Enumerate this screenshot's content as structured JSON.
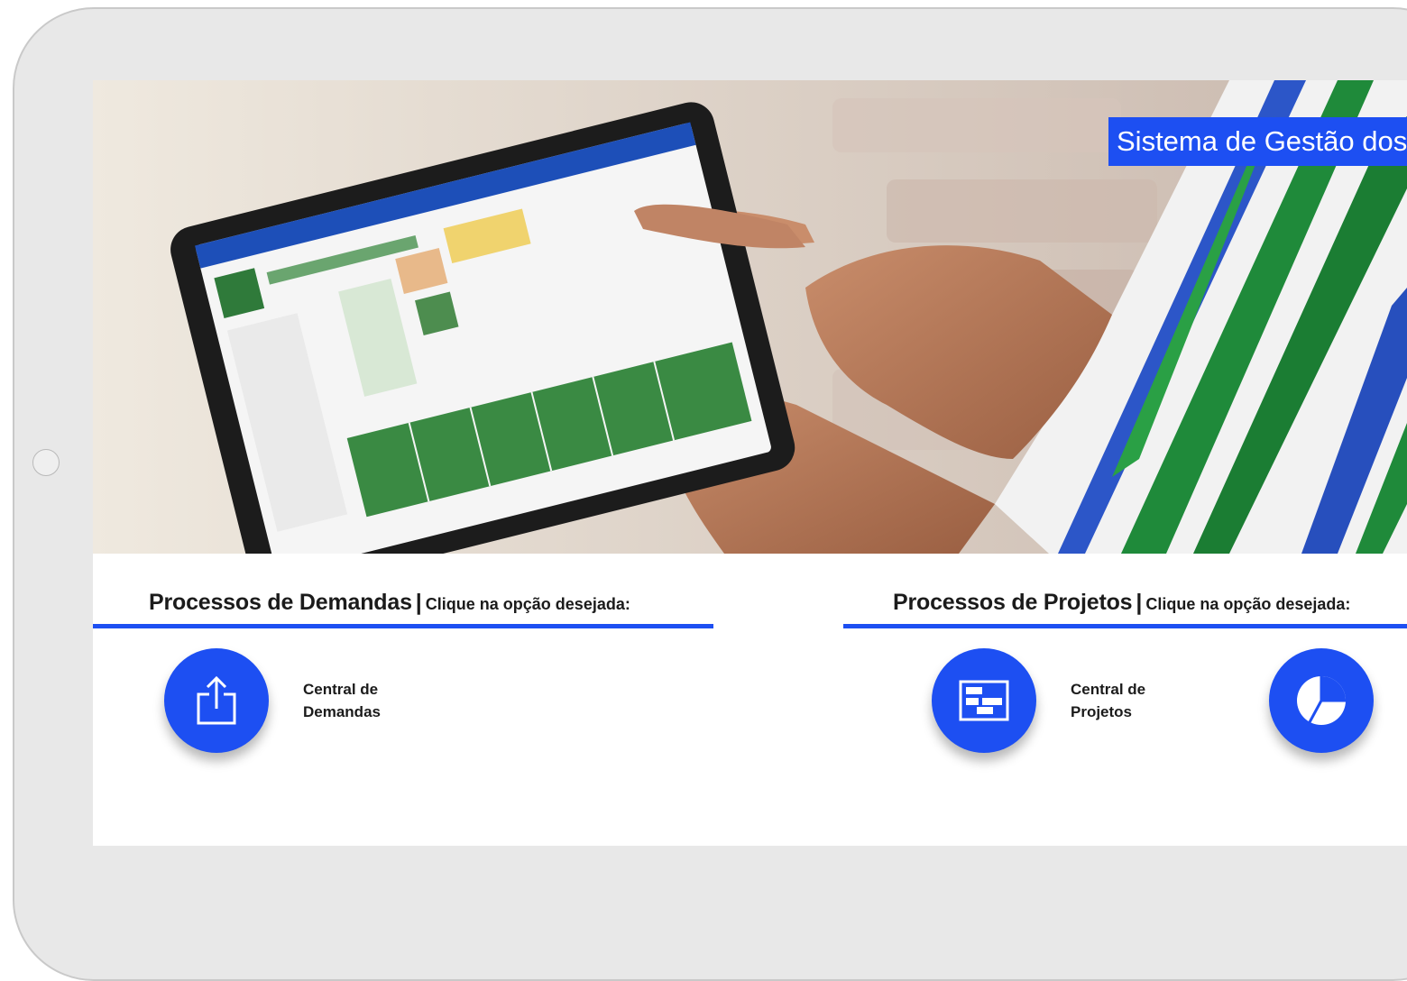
{
  "hero": {
    "title": "Sistema de Gestão dos"
  },
  "sections": [
    {
      "title": "Processos de Demandas",
      "separator": "|",
      "subtitle": "Clique na opção desejada:",
      "tiles": [
        {
          "label": "Central de\nDemandas",
          "icon": "share-upload-icon"
        }
      ]
    },
    {
      "title": "Processos de Projetos",
      "separator": "|",
      "subtitle": "Clique na opção desejada:",
      "tiles": [
        {
          "label": "Central de\nProjetos",
          "icon": "gantt-chart-icon"
        },
        {
          "label": "",
          "icon": "pie-chart-icon"
        }
      ]
    }
  ],
  "colors": {
    "accent": "#1d4ff2",
    "frame": "#e8e8e8",
    "text": "#1b1b1b"
  }
}
